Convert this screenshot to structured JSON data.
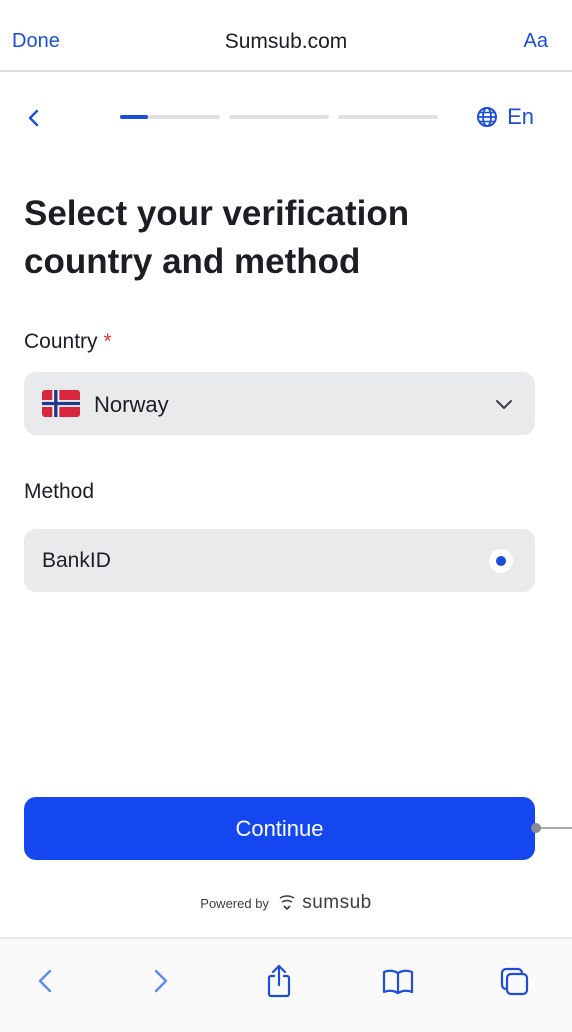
{
  "browser": {
    "done_label": "Done",
    "domain": "Sumsub.com",
    "text_size_label": "Aa"
  },
  "progress": {
    "steps": 3,
    "current_step": 1,
    "current_step_fill": 0.28
  },
  "language": {
    "icon": "globe-icon",
    "label": "En"
  },
  "page": {
    "title": "Select your verification country and method"
  },
  "country": {
    "label": "Country",
    "required_mark": "*",
    "value": "Norway",
    "flag_icon": "norway-flag-icon"
  },
  "method": {
    "label": "Method",
    "value": "BankID",
    "selected": true
  },
  "actions": {
    "continue_label": "Continue"
  },
  "footer": {
    "powered_by": "Powered by",
    "brand": "sumsub"
  },
  "toolbar": {
    "icons": [
      "back-icon",
      "forward-icon",
      "share-icon",
      "bookmarks-icon",
      "tabs-icon"
    ]
  },
  "colors": {
    "accent": "#1447f0",
    "link": "#1d4ed8",
    "field_bg": "#e9eaec",
    "required": "#e03131"
  }
}
